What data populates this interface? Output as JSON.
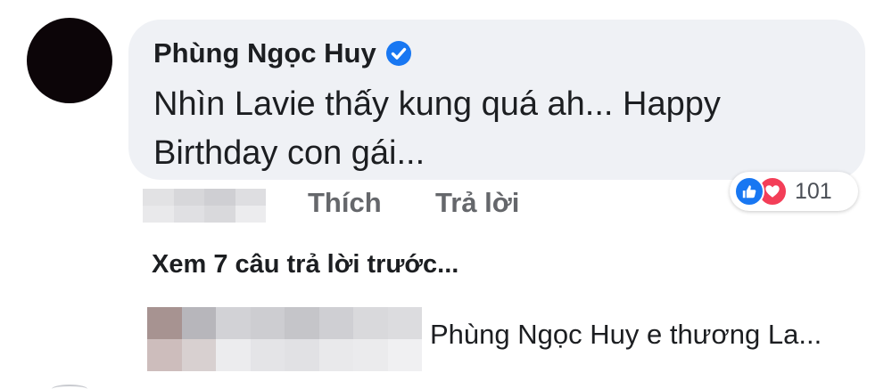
{
  "comment": {
    "author": "Phùng Ngọc Huy",
    "verified": true,
    "text": "Nhìn Lavie thấy kung quá ah... Happy Birthday con gái...",
    "reactions": {
      "icons": [
        "like-icon",
        "love-icon"
      ],
      "count": "101"
    },
    "actions": {
      "like": "Thích",
      "reply": "Trả lời"
    }
  },
  "view_more_replies": "Xem 7 câu trả lời trước...",
  "reply": {
    "text": "Phùng Ngọc Huy e thương La..."
  },
  "colors": {
    "bubble": "#eff1f5",
    "verified_badge": "#1877f2",
    "like": "#1877f2",
    "love": "#f33e58",
    "action_text": "#65676b"
  }
}
